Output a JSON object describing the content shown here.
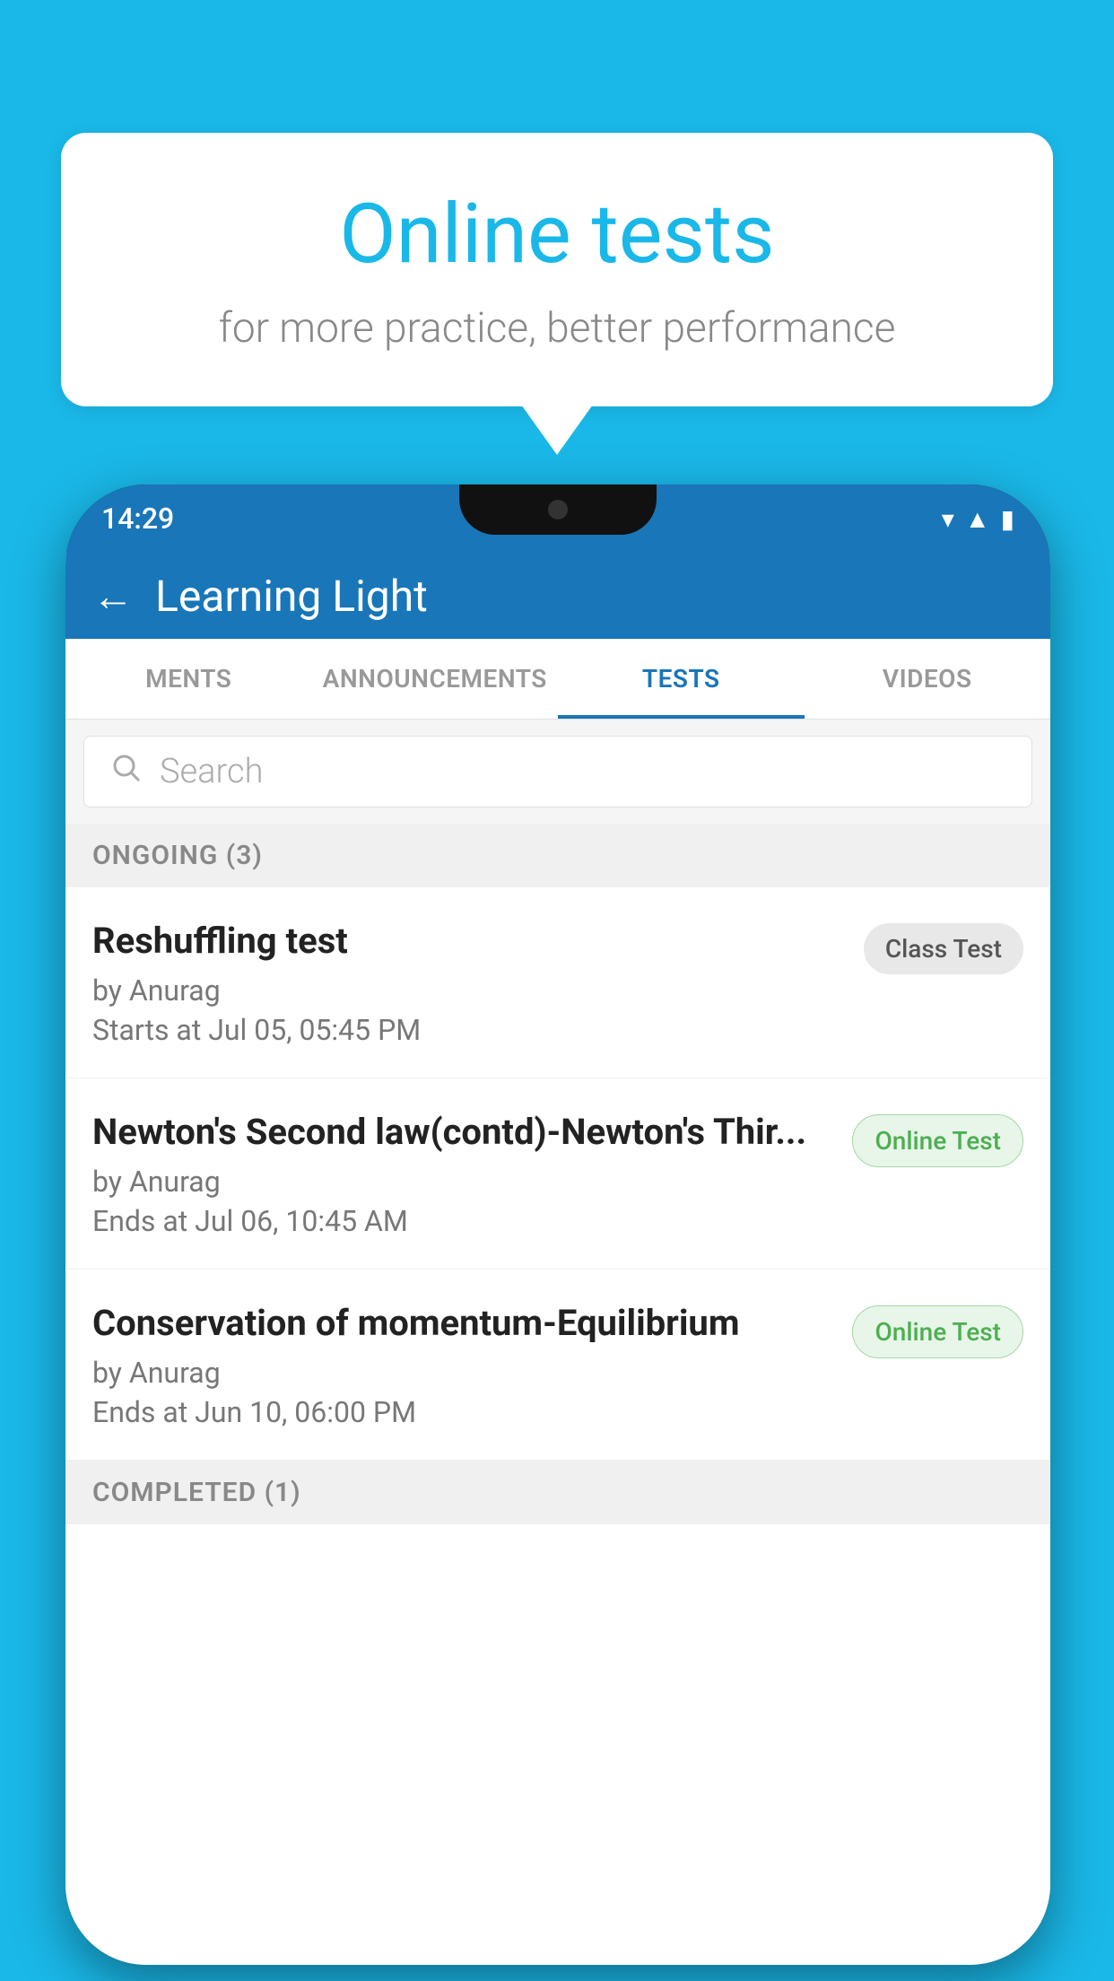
{
  "background_color": "#1ab8e8",
  "speech_bubble": {
    "title": "Online tests",
    "subtitle": "for more practice, better performance"
  },
  "phone": {
    "status_bar": {
      "time": "14:29"
    },
    "header": {
      "title": "Learning Light",
      "back_label": "←"
    },
    "tabs": [
      {
        "label": "MENTS",
        "active": false
      },
      {
        "label": "ANNOUNCEMENTS",
        "active": false
      },
      {
        "label": "TESTS",
        "active": true
      },
      {
        "label": "VIDEOS",
        "active": false
      }
    ],
    "search": {
      "placeholder": "Search"
    },
    "sections": [
      {
        "title": "ONGOING (3)",
        "items": [
          {
            "name": "Reshuffling test",
            "by": "by Anurag",
            "date_label": "Starts at",
            "date": "Jul 05, 05:45 PM",
            "badge": "Class Test",
            "badge_type": "class"
          },
          {
            "name": "Newton's Second law(contd)-Newton's Thir...",
            "by": "by Anurag",
            "date_label": "Ends at",
            "date": "Jul 06, 10:45 AM",
            "badge": "Online Test",
            "badge_type": "online"
          },
          {
            "name": "Conservation of momentum-Equilibrium",
            "by": "by Anurag",
            "date_label": "Ends at",
            "date": "Jun 10, 06:00 PM",
            "badge": "Online Test",
            "badge_type": "online"
          }
        ]
      }
    ],
    "completed_section": "COMPLETED (1)"
  }
}
